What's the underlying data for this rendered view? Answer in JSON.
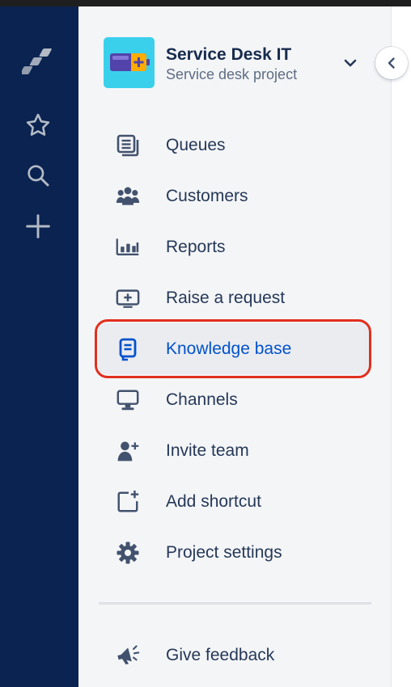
{
  "colors": {
    "global_nav_bg": "#0a2350",
    "sidebar_bg": "#f4f5f7",
    "text_primary": "#253858",
    "text_secondary": "#5e6c84",
    "active_text": "#0052cc",
    "highlight": "#e0301e",
    "project_avatar_bg": "#3ad0ec"
  },
  "global_nav": {
    "items": [
      {
        "name": "jira-logo-icon"
      },
      {
        "name": "star-icon"
      },
      {
        "name": "search-icon"
      },
      {
        "name": "plus-icon"
      }
    ]
  },
  "project": {
    "name": "Service Desk IT",
    "type": "Service desk project",
    "avatar_icon": "battery-icon",
    "chevron_icon": "chevron-down-icon"
  },
  "collapse_icon": "chevron-left-icon",
  "nav": {
    "items": [
      {
        "label": "Queues",
        "icon": "queues-icon",
        "active": false
      },
      {
        "label": "Customers",
        "icon": "customers-icon",
        "active": false
      },
      {
        "label": "Reports",
        "icon": "reports-icon",
        "active": false
      },
      {
        "label": "Raise a request",
        "icon": "raise-request-icon",
        "active": false
      },
      {
        "label": "Knowledge base",
        "icon": "knowledge-base-icon",
        "active": true
      },
      {
        "label": "Channels",
        "icon": "channels-icon",
        "active": false
      },
      {
        "label": "Invite team",
        "icon": "invite-team-icon",
        "active": false
      },
      {
        "label": "Add shortcut",
        "icon": "add-shortcut-icon",
        "active": false
      },
      {
        "label": "Project settings",
        "icon": "settings-icon",
        "active": false
      }
    ]
  },
  "footer": {
    "label": "Give feedback",
    "icon": "megaphone-icon"
  }
}
